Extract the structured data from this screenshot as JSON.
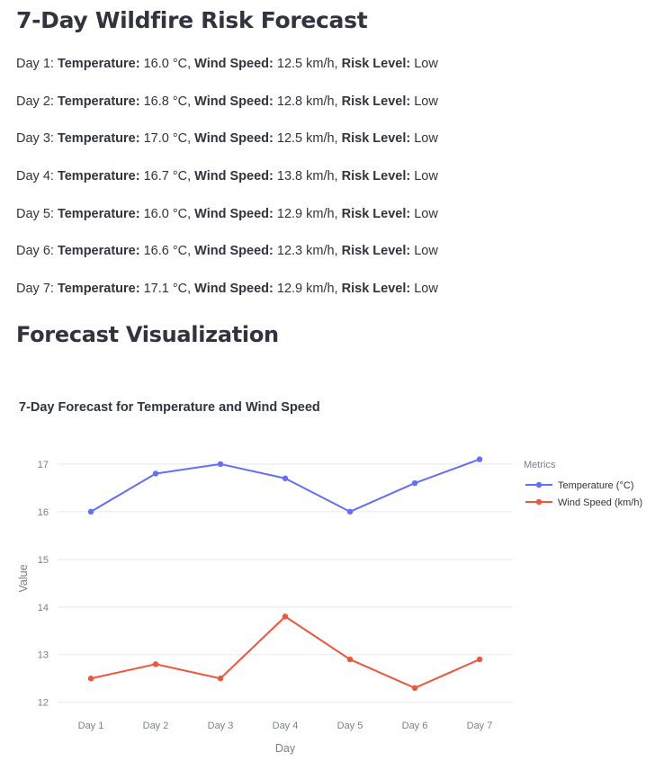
{
  "page": {
    "title": "7-Day Wildfire Risk Forecast",
    "section_title": "Forecast Visualization",
    "field_labels": {
      "temperature": "Temperature:",
      "wind": "Wind Speed:",
      "risk": "Risk Level:"
    },
    "days": [
      {
        "day": "Day 1:",
        "temperature": "16.0 °C,",
        "wind": "12.5 km/h,",
        "risk": "Low"
      },
      {
        "day": "Day 2:",
        "temperature": "16.8 °C,",
        "wind": "12.8 km/h,",
        "risk": "Low"
      },
      {
        "day": "Day 3:",
        "temperature": "17.0 °C,",
        "wind": "12.5 km/h,",
        "risk": "Low"
      },
      {
        "day": "Day 4:",
        "temperature": "16.7 °C,",
        "wind": "13.8 km/h,",
        "risk": "Low"
      },
      {
        "day": "Day 5:",
        "temperature": "16.0 °C,",
        "wind": "12.9 km/h,",
        "risk": "Low"
      },
      {
        "day": "Day 6:",
        "temperature": "16.6 °C,",
        "wind": "12.3 km/h,",
        "risk": "Low"
      },
      {
        "day": "Day 7:",
        "temperature": "17.1 °C,",
        "wind": "12.9 km/h,",
        "risk": "Low"
      }
    ]
  },
  "chart_data": {
    "type": "line",
    "title": "7-Day Forecast for Temperature and Wind Speed",
    "xlabel": "Day",
    "ylabel": "Value",
    "categories": [
      "Day 1",
      "Day 2",
      "Day 3",
      "Day 4",
      "Day 5",
      "Day 6",
      "Day 7"
    ],
    "ylim": [
      11.9,
      17.3
    ],
    "yticks": [
      12,
      13,
      14,
      15,
      16,
      17
    ],
    "grid": true,
    "legend_title": "Metrics",
    "legend_position": "right",
    "series": [
      {
        "name": "Temperature (°C)",
        "color": "#636efa",
        "values": [
          16.0,
          16.8,
          17.0,
          16.7,
          16.0,
          16.6,
          17.1
        ]
      },
      {
        "name": "Wind Speed (km/h)",
        "color": "#ef553b",
        "values": [
          12.5,
          12.8,
          12.5,
          13.8,
          12.9,
          12.3,
          12.9
        ]
      }
    ]
  }
}
